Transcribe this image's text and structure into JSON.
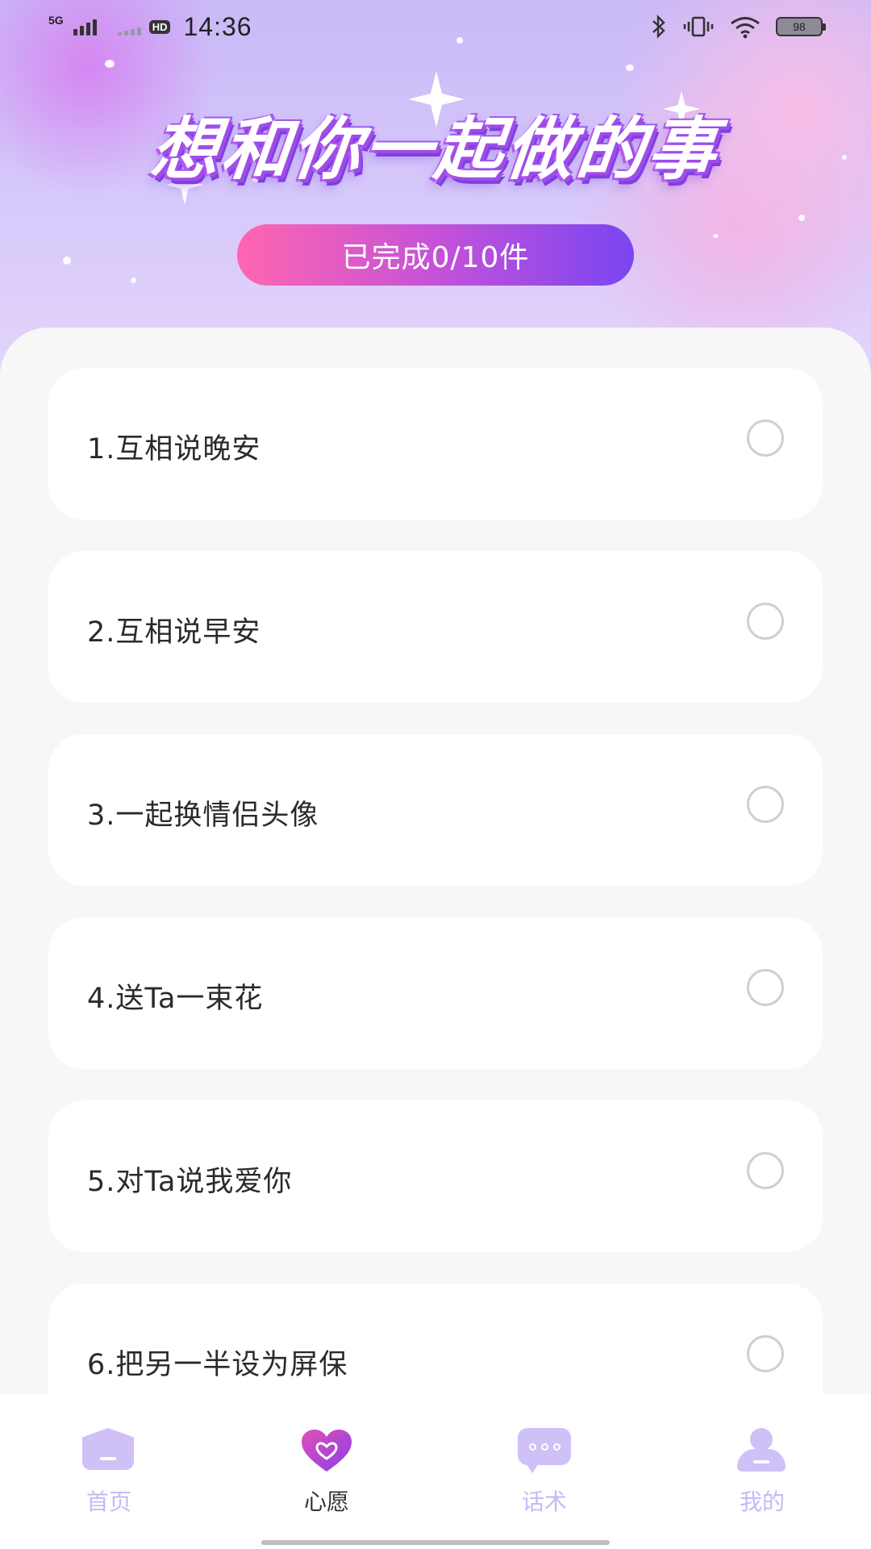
{
  "status_bar": {
    "network_label": "5G",
    "hd_label": "HD",
    "time": "14:36",
    "battery_level": "98",
    "icons": [
      "signal-icon",
      "hd-icon",
      "bluetooth-icon",
      "vibrate-icon",
      "wifi-icon",
      "battery-icon"
    ]
  },
  "header": {
    "title": "想和你一起做的事",
    "progress_text": "已完成0/10件"
  },
  "wishes": [
    {
      "label": "1.互相说晚安",
      "done": false
    },
    {
      "label": "2.互相说早安",
      "done": false
    },
    {
      "label": "3.一起换情侣头像",
      "done": false
    },
    {
      "label": "4.送Ta一束花",
      "done": false
    },
    {
      "label": "5.对Ta说我爱你",
      "done": false
    },
    {
      "label": "6.把另一半设为屏保",
      "done": false
    }
  ],
  "bottom_nav": {
    "items": [
      {
        "label": "首页",
        "icon": "home-icon",
        "active": false
      },
      {
        "label": "心愿",
        "icon": "heart-icon",
        "active": true
      },
      {
        "label": "话术",
        "icon": "chat-icon",
        "active": false
      },
      {
        "label": "我的",
        "icon": "user-icon",
        "active": false
      }
    ]
  },
  "colors": {
    "accent_gradient_start": "#ff66b0",
    "accent_gradient_end": "#7a45f2",
    "nav_inactive": "#c8b8f4",
    "heart": "#b040d8"
  }
}
